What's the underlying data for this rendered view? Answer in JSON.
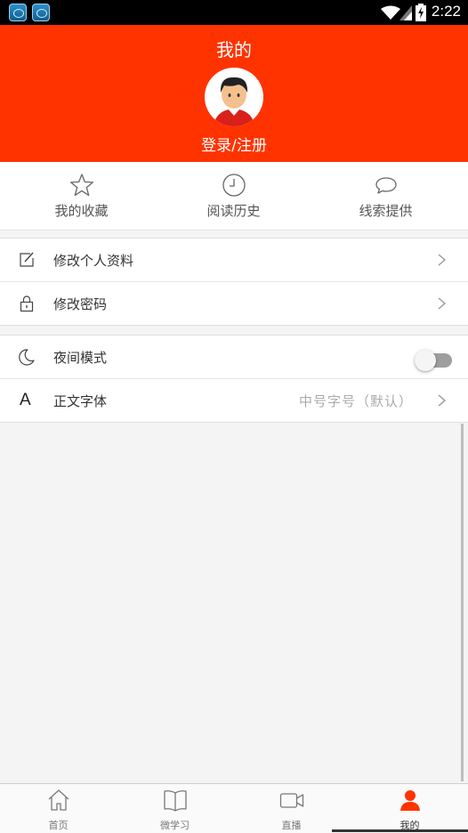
{
  "status_bar": {
    "time": "2:22"
  },
  "header": {
    "title": "我的",
    "login_label": "登录/注册",
    "bg_color": "#ff3300"
  },
  "quick_actions": [
    {
      "label": "我的收藏",
      "icon": "star-icon"
    },
    {
      "label": "阅读历史",
      "icon": "clock-icon"
    },
    {
      "label": "线索提供",
      "icon": "speech-bubble-icon"
    }
  ],
  "settings": {
    "group1": [
      {
        "label": "修改个人资料",
        "icon": "edit-icon"
      },
      {
        "label": "修改密码",
        "icon": "lock-icon"
      }
    ],
    "night_mode": {
      "label": "夜间模式",
      "icon": "moon-icon",
      "enabled": false
    },
    "font": {
      "label": "正文字体",
      "icon": "font-icon",
      "icon_text": "A",
      "value": "中号字号（默认）"
    }
  },
  "bottom_nav": [
    {
      "label": "首页",
      "icon": "home-icon",
      "active": false
    },
    {
      "label": "微学习",
      "icon": "book-icon",
      "active": false
    },
    {
      "label": "直播",
      "icon": "video-camera-icon",
      "active": false
    },
    {
      "label": "我的",
      "icon": "person-icon",
      "active": true
    }
  ],
  "colors": {
    "accent": "#ff3300",
    "active_nav": "#ff3300"
  }
}
